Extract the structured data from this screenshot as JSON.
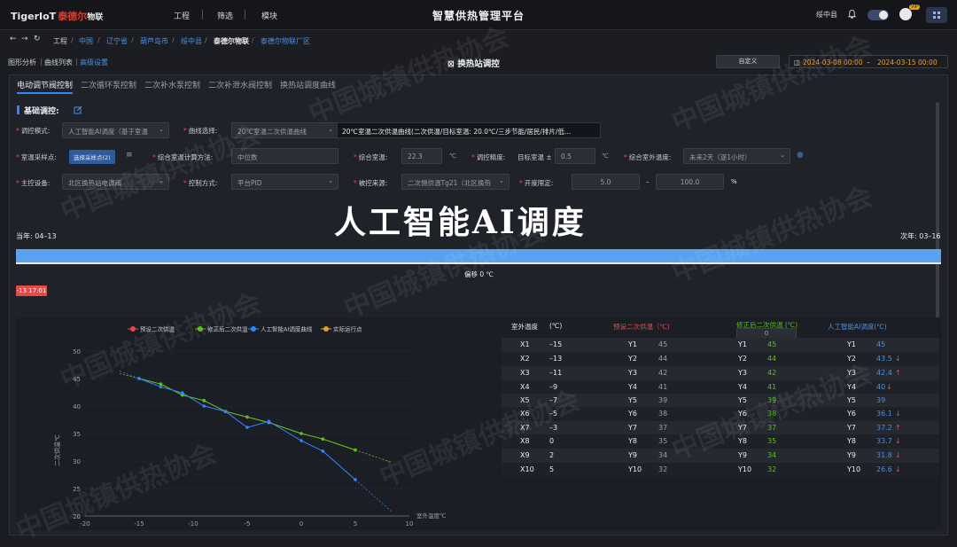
{
  "brand": {
    "en": "TigerIoT",
    "cn": "泰德尔",
    "cn2": "物联"
  },
  "topnav": [
    "工程",
    "筛选",
    "模块"
  ],
  "app_title": "智慧供热管理平台",
  "user": {
    "location": "绥中县",
    "vip": "VIP"
  },
  "breadcrumb": [
    "工程",
    "中国",
    "辽宁省",
    "葫芦岛市",
    "绥中县",
    "泰德尔物联",
    "泰德尔物联厂区"
  ],
  "subtabs": [
    "图形分析",
    "曲线列表",
    "高级设置"
  ],
  "panel_title": "换热站调控",
  "custom_btn": "自定义",
  "date_range": {
    "start": "2024-03-08 00:00",
    "sep": "–",
    "end": "2024-03-15 00:00"
  },
  "tabs": [
    "电动调节阀控制",
    "二次循环泵控制",
    "二次补水泵控制",
    "二次补泄水阀控制",
    "换热站调度曲线"
  ],
  "basic_heading": "基础调控:",
  "form": {
    "mode_label": "调控模式:",
    "mode_value": "人工智能AI调度（基于室温",
    "curve_label": "曲线选择:",
    "curve_value": "20℃室温二次供温曲线",
    "info_text": "20℃室温二次供温曲线(二次供温/目标室温: 20.0℃/三步节能/居民/排片/低…",
    "sample_label": "室温采样点:",
    "sample_btn": "选择采样点(2)",
    "calc_label": "综合室温计算方法:",
    "calc_value": "中位数",
    "room_label": "综合室温:",
    "room_value": "22.3",
    "room_unit": "℃",
    "precision_label": "调控精度:",
    "precision_target": "目标室温 ±",
    "precision_value": "0.5",
    "precision_unit": "℃",
    "outdoor_label": "综合室外温度:",
    "outdoor_value": "未来2天（逐1小时）",
    "device_label": "主控设备:",
    "device_value": "北区换热站电调阀",
    "control_label": "控制方式:",
    "control_value": "平台PID",
    "source_label": "被控来源:",
    "source_value": "二次侧供温Tg21（北区换热",
    "opening_label": "开度限定:",
    "opening_min": "5.0",
    "opening_dash": "–",
    "opening_max": "100.0",
    "opening_unit": "%"
  },
  "big_title": "人工智能AI调度",
  "season": {
    "left": "当年: 04–13",
    "right": "次年: 03–16"
  },
  "season_progress": 1.0,
  "offset_label": "偏移 0 ℃",
  "time_tag": "-13 17:01",
  "watermark": "中国城镇供热协会",
  "chart_data": {
    "type": "line",
    "legend": [
      "预设二次供温",
      "修正后二次供温",
      "人工智能AI调度曲线",
      "实际运行点"
    ],
    "colors": {
      "preset": "#e24b4b",
      "corrected": "#52c41a",
      "ai": "#2f86ff",
      "actual": "#e0a51e"
    },
    "ylabel": "二次供温℃",
    "xlabel": "室外温度℃",
    "xlim": [
      -20,
      10
    ],
    "ylim": [
      20,
      50
    ],
    "xticks": [
      -20,
      -15,
      -10,
      -5,
      0,
      5,
      10
    ],
    "yticks": [
      20,
      25,
      30,
      35,
      40,
      45,
      50
    ],
    "series": [
      {
        "name": "预设二次供温",
        "x": [
          -15,
          -13,
          -11,
          -9,
          -7,
          -5,
          -3,
          0,
          2,
          5
        ],
        "values": [
          45,
          44,
          42,
          41,
          39,
          38,
          37,
          35,
          34,
          32
        ]
      },
      {
        "name": "修正后二次供温",
        "x": [
          -15,
          -13,
          -11,
          -9,
          -7,
          -5,
          -3,
          0,
          2,
          5
        ],
        "values": [
          45,
          44,
          42,
          41,
          39,
          38,
          37,
          35,
          34,
          32
        ]
      },
      {
        "name": "人工智能AI调度曲线",
        "x": [
          -15,
          -13,
          -11,
          -9,
          -7,
          -5,
          -3,
          0,
          2,
          5
        ],
        "values": [
          45,
          43.5,
          42.4,
          40,
          39,
          36.1,
          37.2,
          33.7,
          31.8,
          26.6
        ]
      }
    ]
  },
  "table": {
    "headers": {
      "outdoor": "室外温度",
      "outdoor_unit": "(℃)",
      "preset": "预设二次供温（℃)",
      "corrected": "修正后二次供温 (℃)",
      "ai": "人工智能AI调度(℃)"
    },
    "stepper_value": "0",
    "rows": [
      {
        "x": "X1",
        "xv": "–15",
        "y": "Y1",
        "p": "45",
        "cy": "Y1",
        "c": "45",
        "ay": "Y1",
        "a": "45",
        "arrow": ""
      },
      {
        "x": "X2",
        "xv": "–13",
        "y": "Y2",
        "p": "44",
        "cy": "Y2",
        "c": "44",
        "ay": "Y2",
        "a": "43.5",
        "arrow": "↓"
      },
      {
        "x": "X3",
        "xv": "–11",
        "y": "Y3",
        "p": "42",
        "cy": "Y3",
        "c": "42",
        "ay": "Y3",
        "a": "42.4",
        "arrow": "↑"
      },
      {
        "x": "X4",
        "xv": "–9",
        "y": "Y4",
        "p": "41",
        "cy": "Y4",
        "c": "41",
        "ay": "Y4",
        "a": "40",
        "arrow": "↓"
      },
      {
        "x": "X5",
        "xv": "–7",
        "y": "Y5",
        "p": "39",
        "cy": "Y5",
        "c": "39",
        "ay": "Y5",
        "a": "39",
        "arrow": ""
      },
      {
        "x": "X6",
        "xv": "–5",
        "y": "Y6",
        "p": "38",
        "cy": "Y6",
        "c": "38",
        "ay": "Y6",
        "a": "36.1",
        "arrow": "↓"
      },
      {
        "x": "X7",
        "xv": "–3",
        "y": "Y7",
        "p": "37",
        "cy": "Y7",
        "c": "37",
        "ay": "Y7",
        "a": "37.2",
        "arrow": "↑"
      },
      {
        "x": "X8",
        "xv": "0",
        "y": "Y8",
        "p": "35",
        "cy": "Y8",
        "c": "35",
        "ay": "Y8",
        "a": "33.7",
        "arrow": "↓"
      },
      {
        "x": "X9",
        "xv": "2",
        "y": "Y9",
        "p": "34",
        "cy": "Y9",
        "c": "34",
        "ay": "Y9",
        "a": "31.8",
        "arrow": "↓"
      },
      {
        "x": "X10",
        "xv": "5",
        "y": "Y10",
        "p": "32",
        "cy": "Y10",
        "c": "32",
        "ay": "Y10",
        "a": "26.6",
        "arrow": "↓"
      }
    ]
  }
}
